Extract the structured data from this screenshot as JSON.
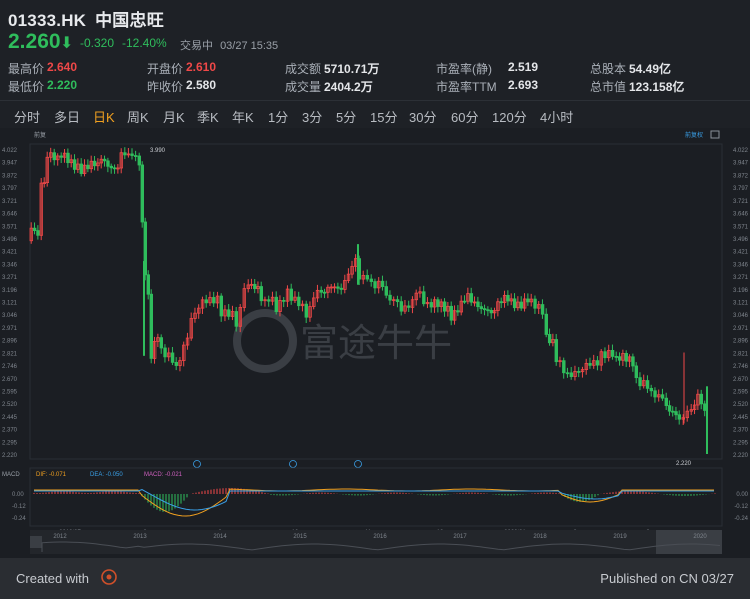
{
  "header": {
    "symbol": "01333.HK",
    "name": "中国忠旺",
    "price": "2.260",
    "arrow": "⬇",
    "change": "-0.320",
    "change_pct": "-12.40%",
    "status": "交易中",
    "datetime": "03/27 15:35"
  },
  "stats": [
    {
      "label": "最高价",
      "value": "2.640",
      "color": "red"
    },
    {
      "label": "最低价",
      "value": "2.220",
      "color": "green"
    },
    {
      "label": "开盘价",
      "value": "2.610",
      "color": "red"
    },
    {
      "label": "昨收价",
      "value": "2.580",
      "color": "white"
    },
    {
      "label": "成交额",
      "value": "5710.71万",
      "color": "white"
    },
    {
      "label": "成交量",
      "value": "2404.2万",
      "color": "white"
    },
    {
      "label": "市盈率(静)",
      "value": "2.519",
      "color": "white"
    },
    {
      "label": "市盈率TTM",
      "value": "2.693",
      "color": "white"
    },
    {
      "label": "总股本",
      "value": "54.49亿",
      "color": "white"
    },
    {
      "label": "总市值",
      "value": "123.158亿",
      "color": "white"
    }
  ],
  "tabs": [
    "分时",
    "多日",
    "日K",
    "周K",
    "月K",
    "季K",
    "年K",
    "1分",
    "3分",
    "5分",
    "15分",
    "30分",
    "60分",
    "120分",
    "4小时"
  ],
  "active_tab": "日K",
  "chart": {
    "corner_label": "前复权",
    "top_left_label": "前复",
    "high_label": "3.990",
    "low_label": "2.220",
    "watermark": "富途牛牛",
    "macd_label": "MACD",
    "dif_label": "DIF: -0.071",
    "dea_label": "DEA: -0.050",
    "macd_value_label": "MACD: -0.021",
    "timeline_marks": [
      "2019/07",
      "8",
      "9",
      "10",
      "11",
      "12",
      "2020/01",
      "2",
      "3"
    ],
    "overview_years": [
      "2012",
      "2013",
      "2014",
      "2015",
      "2016",
      "2017",
      "2018",
      "2019",
      "2020"
    ],
    "macd_ticks": [
      "0.00",
      "-0.12",
      "-0.24"
    ],
    "colors": {
      "up": "#f04848",
      "down": "#2fbd5c",
      "dif": "#f0a020",
      "dea": "#3aa0e8",
      "grid": "#2a2e34"
    }
  },
  "chart_data": {
    "type": "candlestick",
    "ylim": [
      2.22,
      4.022
    ],
    "y_ticks": [
      "4.022",
      "3.947",
      "3.872",
      "3.797",
      "3.721",
      "3.646",
      "3.571",
      "3.496",
      "3.421",
      "3.346",
      "3.271",
      "3.196",
      "3.121",
      "3.046",
      "2.971",
      "2.896",
      "2.821",
      "2.746",
      "2.670",
      "2.595",
      "2.520",
      "2.445",
      "2.370",
      "2.295",
      "2.220"
    ]
  },
  "footer": {
    "left": "Created with",
    "right": "Published on CN 03/27"
  }
}
